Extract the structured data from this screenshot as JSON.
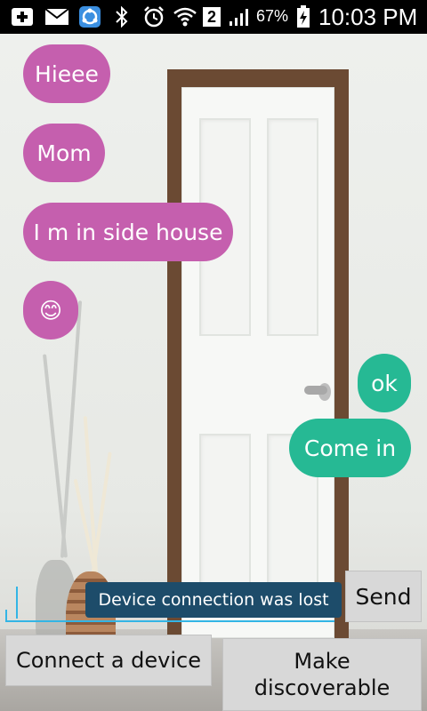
{
  "status_bar": {
    "sim_number": "2",
    "battery_percent": "67%",
    "time": "10:03 PM",
    "icons": [
      "add-icon",
      "mail-icon",
      "sync-app-icon",
      "bluetooth-icon",
      "alarm-icon",
      "wifi-icon",
      "sim-icon",
      "signal-icon",
      "battery-charging-icon"
    ]
  },
  "messages": [
    {
      "direction": "incoming",
      "text": "Hieee"
    },
    {
      "direction": "incoming",
      "text": "Mom"
    },
    {
      "direction": "incoming",
      "text": "I m in side house"
    },
    {
      "direction": "incoming",
      "text": "😊"
    },
    {
      "direction": "outgoing",
      "text": "ok"
    },
    {
      "direction": "outgoing",
      "text": "Come in"
    }
  ],
  "composer": {
    "value": "",
    "send_label": "Send"
  },
  "toast": {
    "text": "Device connection was lost"
  },
  "actions": {
    "connect_label": "Connect a device",
    "discoverable_label_line1": "Make",
    "discoverable_label_line2": "discoverable"
  },
  "colors": {
    "incoming_bubble": "#c55fae",
    "outgoing_bubble": "#26b994",
    "accent": "#33b5e5",
    "toast_bg": "#1d4c6a"
  }
}
